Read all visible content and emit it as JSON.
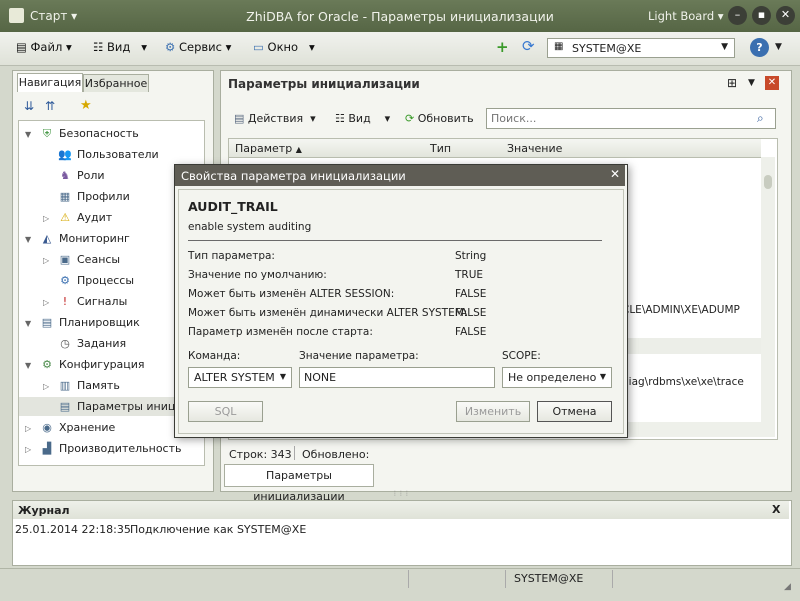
{
  "window": {
    "start_label": "Старт",
    "title": "ZhiDBA for Oracle - Параметры инициализации",
    "theme": "Light Board"
  },
  "menubar": {
    "file": "Файл",
    "view": "Вид",
    "service": "Сервис",
    "window": "Окно",
    "connection": "SYSTEM@XE"
  },
  "nav": {
    "tabs": [
      "Навигация",
      "Избранное"
    ],
    "tree": [
      {
        "label": "Безопасность",
        "level": 0,
        "icon": "shield-icon",
        "expand": "▼"
      },
      {
        "label": "Пользователи",
        "level": 1,
        "icon": "users-icon"
      },
      {
        "label": "Роли",
        "level": 1,
        "icon": "roles-icon"
      },
      {
        "label": "Профили",
        "level": 1,
        "icon": "profiles-icon"
      },
      {
        "label": "Аудит",
        "level": 1,
        "icon": "warning-icon",
        "expand": "▷"
      },
      {
        "label": "Мониторинг",
        "level": 0,
        "icon": "monitoring-icon",
        "expand": "▼"
      },
      {
        "label": "Сеансы",
        "level": 1,
        "icon": "sessions-icon",
        "expand": "▷"
      },
      {
        "label": "Процессы",
        "level": 1,
        "icon": "gears-icon"
      },
      {
        "label": "Сигналы",
        "level": 1,
        "icon": "alert-icon",
        "expand": "▷"
      },
      {
        "label": "Планировщик",
        "level": 0,
        "icon": "calendar-icon",
        "expand": "▼"
      },
      {
        "label": "Задания",
        "level": 1,
        "icon": "clock-icon"
      },
      {
        "label": "Конфигурация",
        "level": 0,
        "icon": "config-icon",
        "expand": "▼"
      },
      {
        "label": "Память",
        "level": 1,
        "icon": "memory-icon",
        "expand": "▷"
      },
      {
        "label": "Параметры инициализ",
        "level": 1,
        "icon": "params-icon",
        "selected": true
      },
      {
        "label": "Хранение",
        "level": 0,
        "icon": "storage-icon",
        "expand": "▷"
      },
      {
        "label": "Производительность",
        "level": 0,
        "icon": "performance-icon",
        "expand": "▷"
      }
    ]
  },
  "main": {
    "title": "Параметры инициализации",
    "toolbar": {
      "actions": "Действия",
      "view": "Вид",
      "refresh": "Обновить",
      "search_placeholder": "Поиск..."
    },
    "columns": [
      "Параметр",
      "Тип",
      "Значение"
    ],
    "visible_values": [
      "CLE\\ADMIN\\XE\\ADUMP",
      "diag\\rdbms\\xe\\xe\\trace"
    ],
    "status": {
      "rows": "Строк: 343",
      "updated": "Обновлено:"
    },
    "bottom_tab": "Параметры инициализации"
  },
  "dialog": {
    "title": "Свойства параметра инициализации",
    "param_name": "AUDIT_TRAIL",
    "param_desc": "enable system auditing",
    "props": [
      {
        "label": "Тип параметра:",
        "value": "String"
      },
      {
        "label": "Значение по умолчанию:",
        "value": "TRUE"
      },
      {
        "label": "Может быть изменён ALTER SESSION:",
        "value": "FALSE"
      },
      {
        "label": "Может быть изменён динамически ALTER SYSTEM:",
        "value": "FALSE"
      },
      {
        "label": "Параметр изменён после старта:",
        "value": "FALSE"
      }
    ],
    "command_label": "Команда:",
    "command_value": "ALTER SYSTEM",
    "value_label": "Значение параметра:",
    "value_value": "NONE",
    "scope_label": "SCOPE:",
    "scope_value": "Не определено",
    "sql_button": "SQL",
    "change_button": "Изменить",
    "cancel_button": "Отмена"
  },
  "journal": {
    "title": "Журнал",
    "close": "X",
    "entries": [
      {
        "time": "25.01.2014 22:18:35",
        "text": "Подключение как SYSTEM@XE"
      }
    ]
  },
  "statusbar": {
    "connection": "SYSTEM@XE"
  }
}
